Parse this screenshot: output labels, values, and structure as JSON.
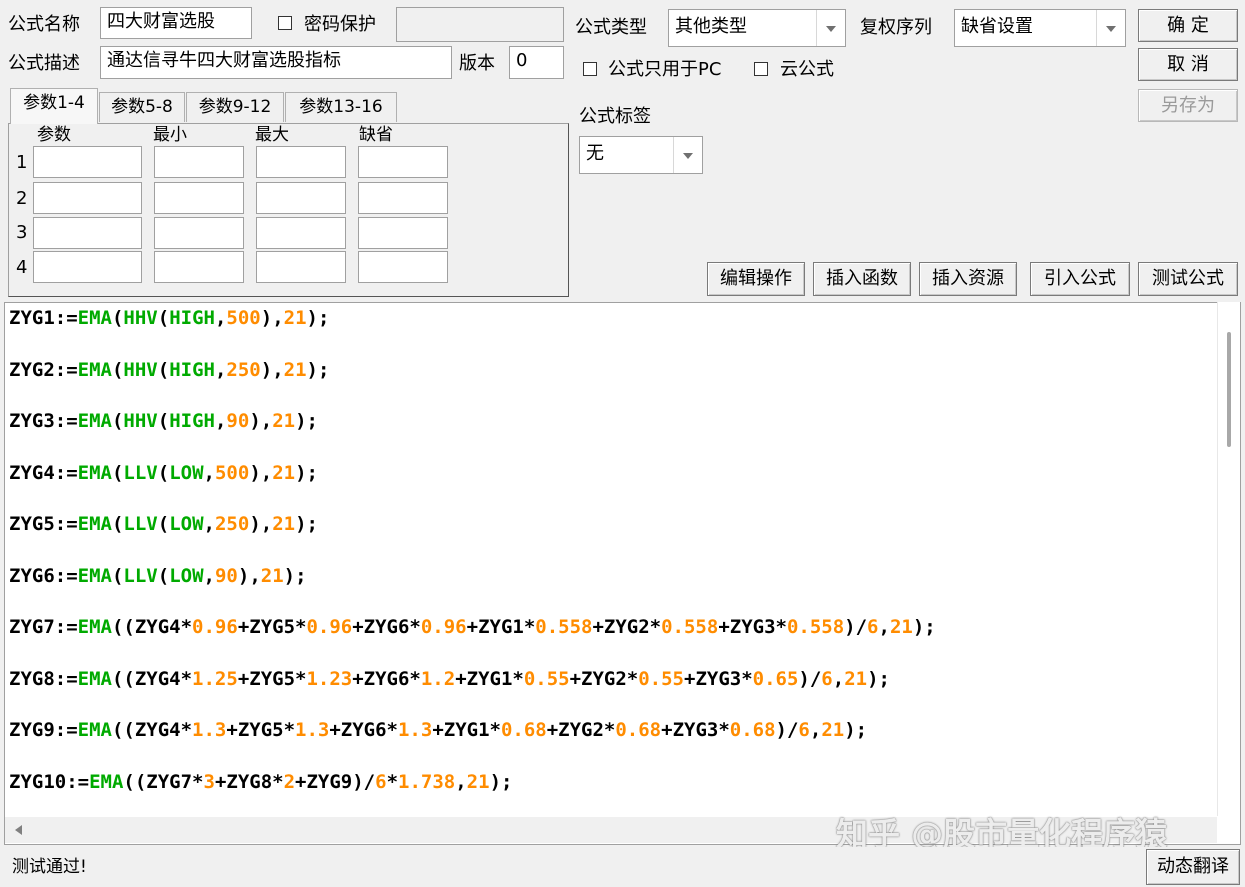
{
  "header": {
    "name_label": "公式名称",
    "name_value": "四大财富选股",
    "password_label": "密码保护",
    "password_value": "",
    "desc_label": "公式描述",
    "desc_value": "通达信寻牛四大财富选股指标",
    "version_label": "版本",
    "version_value": "0",
    "type_label": "公式类型",
    "type_value": "其他类型",
    "rights_label": "复权序列",
    "rights_value": "缺省设置",
    "pc_only_label": "公式只用于PC",
    "cloud_label": "云公式",
    "tag_label": "公式标签",
    "tag_value": "无"
  },
  "buttons": {
    "ok": "确  定",
    "cancel": "取  消",
    "save_as": "另存为",
    "edit_ops": "编辑操作",
    "insert_func": "插入函数",
    "insert_res": "插入资源",
    "import_formula": "引入公式",
    "test_formula": "测试公式",
    "dynamic_translate": "动态翻译"
  },
  "tabs": [
    "参数1-4",
    "参数5-8",
    "参数9-12",
    "参数13-16"
  ],
  "params": {
    "col_headers": [
      "参数",
      "最小",
      "最大",
      "缺省"
    ],
    "rows": [
      "1",
      "2",
      "3",
      "4"
    ]
  },
  "code": [
    [
      [
        "t",
        "ZYG1:="
      ],
      [
        "f",
        "EMA"
      ],
      [
        "t",
        "("
      ],
      [
        "f",
        "HHV"
      ],
      [
        "t",
        "("
      ],
      [
        "f",
        "HIGH"
      ],
      [
        "t",
        ","
      ],
      [
        "n",
        "500"
      ],
      [
        "t",
        "),"
      ],
      [
        "n",
        "21"
      ],
      [
        "t",
        ");"
      ]
    ],
    [
      [
        "t",
        "ZYG2:="
      ],
      [
        "f",
        "EMA"
      ],
      [
        "t",
        "("
      ],
      [
        "f",
        "HHV"
      ],
      [
        "t",
        "("
      ],
      [
        "f",
        "HIGH"
      ],
      [
        "t",
        ","
      ],
      [
        "n",
        "250"
      ],
      [
        "t",
        "),"
      ],
      [
        "n",
        "21"
      ],
      [
        "t",
        ");"
      ]
    ],
    [
      [
        "t",
        "ZYG3:="
      ],
      [
        "f",
        "EMA"
      ],
      [
        "t",
        "("
      ],
      [
        "f",
        "HHV"
      ],
      [
        "t",
        "("
      ],
      [
        "f",
        "HIGH"
      ],
      [
        "t",
        ","
      ],
      [
        "n",
        "90"
      ],
      [
        "t",
        "),"
      ],
      [
        "n",
        "21"
      ],
      [
        "t",
        ");"
      ]
    ],
    [
      [
        "t",
        "ZYG4:="
      ],
      [
        "f",
        "EMA"
      ],
      [
        "t",
        "("
      ],
      [
        "f",
        "LLV"
      ],
      [
        "t",
        "("
      ],
      [
        "f",
        "LOW"
      ],
      [
        "t",
        ","
      ],
      [
        "n",
        "500"
      ],
      [
        "t",
        "),"
      ],
      [
        "n",
        "21"
      ],
      [
        "t",
        ");"
      ]
    ],
    [
      [
        "t",
        "ZYG5:="
      ],
      [
        "f",
        "EMA"
      ],
      [
        "t",
        "("
      ],
      [
        "f",
        "LLV"
      ],
      [
        "t",
        "("
      ],
      [
        "f",
        "LOW"
      ],
      [
        "t",
        ","
      ],
      [
        "n",
        "250"
      ],
      [
        "t",
        "),"
      ],
      [
        "n",
        "21"
      ],
      [
        "t",
        ");"
      ]
    ],
    [
      [
        "t",
        "ZYG6:="
      ],
      [
        "f",
        "EMA"
      ],
      [
        "t",
        "("
      ],
      [
        "f",
        "LLV"
      ],
      [
        "t",
        "("
      ],
      [
        "f",
        "LOW"
      ],
      [
        "t",
        ","
      ],
      [
        "n",
        "90"
      ],
      [
        "t",
        "),"
      ],
      [
        "n",
        "21"
      ],
      [
        "t",
        ");"
      ]
    ],
    [
      [
        "t",
        "ZYG7:="
      ],
      [
        "f",
        "EMA"
      ],
      [
        "t",
        "((ZYG4*"
      ],
      [
        "n",
        "0.96"
      ],
      [
        "t",
        "+ZYG5*"
      ],
      [
        "n",
        "0.96"
      ],
      [
        "t",
        "+ZYG6*"
      ],
      [
        "n",
        "0.96"
      ],
      [
        "t",
        "+ZYG1*"
      ],
      [
        "n",
        "0.558"
      ],
      [
        "t",
        "+ZYG2*"
      ],
      [
        "n",
        "0.558"
      ],
      [
        "t",
        "+ZYG3*"
      ],
      [
        "n",
        "0.558"
      ],
      [
        "t",
        ")/"
      ],
      [
        "n",
        "6"
      ],
      [
        "t",
        ","
      ],
      [
        "n",
        "21"
      ],
      [
        "t",
        ");"
      ]
    ],
    [
      [
        "t",
        "ZYG8:="
      ],
      [
        "f",
        "EMA"
      ],
      [
        "t",
        "((ZYG4*"
      ],
      [
        "n",
        "1.25"
      ],
      [
        "t",
        "+ZYG5*"
      ],
      [
        "n",
        "1.23"
      ],
      [
        "t",
        "+ZYG6*"
      ],
      [
        "n",
        "1.2"
      ],
      [
        "t",
        "+ZYG1*"
      ],
      [
        "n",
        "0.55"
      ],
      [
        "t",
        "+ZYG2*"
      ],
      [
        "n",
        "0.55"
      ],
      [
        "t",
        "+ZYG3*"
      ],
      [
        "n",
        "0.65"
      ],
      [
        "t",
        ")/"
      ],
      [
        "n",
        "6"
      ],
      [
        "t",
        ","
      ],
      [
        "n",
        "21"
      ],
      [
        "t",
        ");"
      ]
    ],
    [
      [
        "t",
        "ZYG9:="
      ],
      [
        "f",
        "EMA"
      ],
      [
        "t",
        "((ZYG4*"
      ],
      [
        "n",
        "1.3"
      ],
      [
        "t",
        "+ZYG5*"
      ],
      [
        "n",
        "1.3"
      ],
      [
        "t",
        "+ZYG6*"
      ],
      [
        "n",
        "1.3"
      ],
      [
        "t",
        "+ZYG1*"
      ],
      [
        "n",
        "0.68"
      ],
      [
        "t",
        "+ZYG2*"
      ],
      [
        "n",
        "0.68"
      ],
      [
        "t",
        "+ZYG3*"
      ],
      [
        "n",
        "0.68"
      ],
      [
        "t",
        ")/"
      ],
      [
        "n",
        "6"
      ],
      [
        "t",
        ","
      ],
      [
        "n",
        "21"
      ],
      [
        "t",
        ");"
      ]
    ],
    [
      [
        "t",
        "ZYG10:="
      ],
      [
        "f",
        "EMA"
      ],
      [
        "t",
        "((ZYG7*"
      ],
      [
        "n",
        "3"
      ],
      [
        "t",
        "+ZYG8*"
      ],
      [
        "n",
        "2"
      ],
      [
        "t",
        "+ZYG9)/"
      ],
      [
        "n",
        "6"
      ],
      [
        "t",
        "*"
      ],
      [
        "n",
        "1.738"
      ],
      [
        "t",
        ","
      ],
      [
        "n",
        "21"
      ],
      [
        "t",
        ");"
      ]
    ]
  ],
  "status_text": "测试通过!",
  "watermark": "知乎 @股市量化程序猿",
  "colors": {
    "function": "#00aa00",
    "number": "#ff8c00",
    "text": "#000000"
  }
}
